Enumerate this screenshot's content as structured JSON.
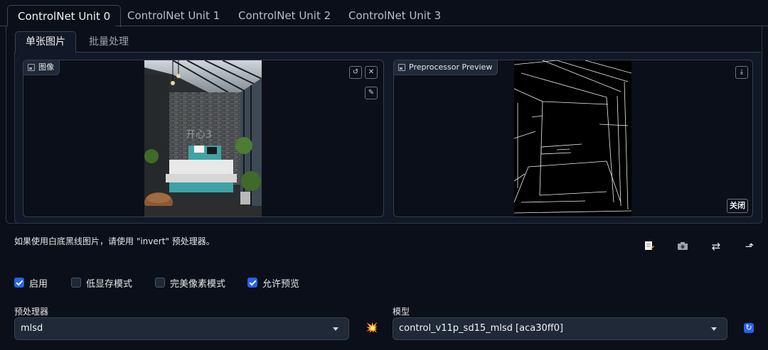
{
  "unit_tabs": [
    "ControlNet Unit 0",
    "ControlNet Unit 1",
    "ControlNet Unit 2",
    "ControlNet Unit 3"
  ],
  "sub_tabs": [
    "单张图片",
    "批量处理"
  ],
  "image_box": {
    "label": "图像"
  },
  "preview_box": {
    "label": "Preprocessor Preview",
    "close_label": "关闭"
  },
  "watermark": "开心3",
  "hint": "如果使用白底黑线图片，请使用 \"invert\" 预处理器。",
  "toolbar_icons": [
    "new-canvas-icon",
    "camera-icon",
    "swap-icon",
    "send-dimensions-icon"
  ],
  "checkboxes": [
    {
      "label": "启用",
      "checked": true
    },
    {
      "label": "低显存模式",
      "checked": false
    },
    {
      "label": "完美像素模式",
      "checked": false
    },
    {
      "label": "允许预览",
      "checked": true
    }
  ],
  "preprocessor": {
    "label": "预处理器",
    "value": "mlsd"
  },
  "model": {
    "label": "模型",
    "value": "control_v11p_sd15_mlsd [aca30ff0]"
  },
  "colors": {
    "accent": "#2563eb",
    "background": "#0b0f19",
    "panel": "#111827",
    "input": "#1f2937"
  }
}
